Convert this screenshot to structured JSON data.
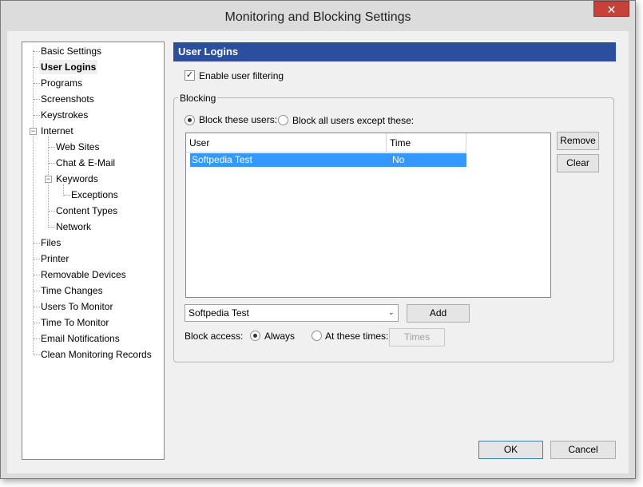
{
  "window": {
    "title": "Monitoring and Blocking Settings",
    "close_glyph": "✕"
  },
  "tree": {
    "items": [
      {
        "label": "Basic Settings"
      },
      {
        "label": "User Logins",
        "selected": true
      },
      {
        "label": "Programs"
      },
      {
        "label": "Screenshots"
      },
      {
        "label": "Keystrokes"
      },
      {
        "label": "Internet",
        "expander": "−"
      },
      {
        "label": "Web Sites"
      },
      {
        "label": "Chat & E-Mail"
      },
      {
        "label": "Keywords",
        "expander": "−"
      },
      {
        "label": "Exceptions"
      },
      {
        "label": "Content Types"
      },
      {
        "label": "Network"
      },
      {
        "label": "Files"
      },
      {
        "label": "Printer"
      },
      {
        "label": "Removable Devices"
      },
      {
        "label": "Time Changes"
      },
      {
        "label": "Users To Monitor"
      },
      {
        "label": "Time To Monitor"
      },
      {
        "label": "Email Notifications"
      },
      {
        "label": "Clean Monitoring Records"
      }
    ]
  },
  "panel": {
    "header": "User Logins",
    "enable_filtering": {
      "label": "Enable user filtering",
      "checked": true,
      "mark": "✓"
    },
    "blocking": {
      "title": "Blocking",
      "radio_block_these": {
        "label": "Block these users:",
        "selected": true
      },
      "radio_block_except": {
        "label": "Block all users except these:",
        "selected": false
      },
      "table": {
        "columns": [
          "User",
          "Time"
        ],
        "rows": [
          {
            "user": "Softpedia Test",
            "time": "No",
            "selected": true
          }
        ]
      },
      "remove_label": "Remove",
      "clear_label": "Clear",
      "user_select_value": "Softpedia Test",
      "select_arrow": "⌄",
      "add_label": "Add",
      "block_access_label": "Block access:",
      "radio_always": {
        "label": "Always",
        "selected": true
      },
      "radio_at_times": {
        "label": "At these times:",
        "selected": false
      },
      "times_label": "Times"
    }
  },
  "footer": {
    "ok_label": "OK",
    "cancel_label": "Cancel"
  },
  "colors": {
    "header_bg": "#2b4f9e",
    "selection": "#3399ff",
    "close_bg": "#c7413a"
  }
}
